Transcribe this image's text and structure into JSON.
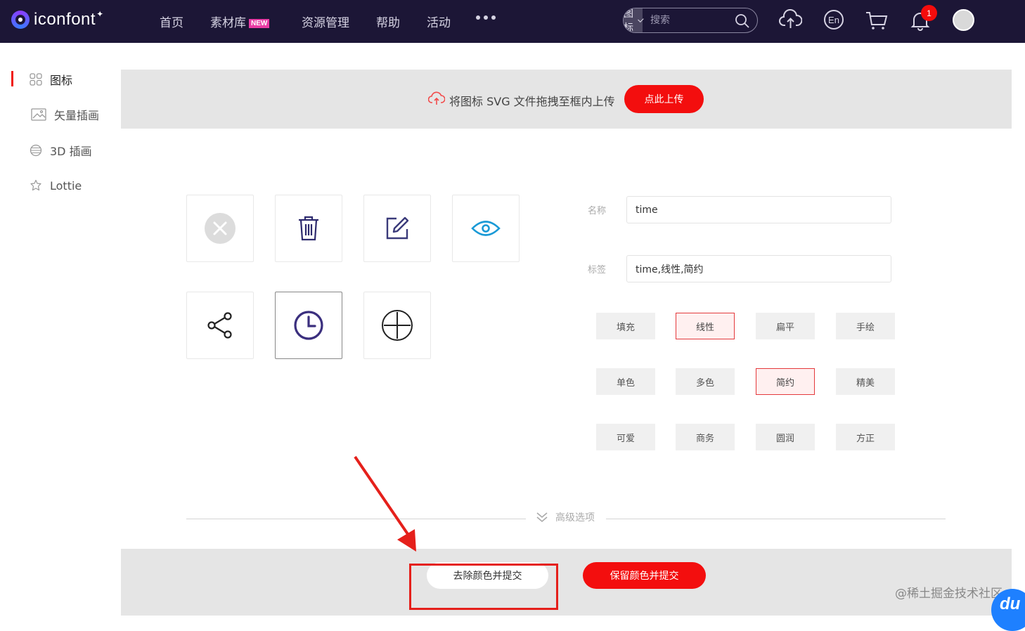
{
  "header": {
    "logo_text": "iconfont",
    "nav": [
      {
        "label": "首页"
      },
      {
        "label": "素材库",
        "badge": "NEW"
      },
      {
        "label": "资源管理"
      },
      {
        "label": "帮助"
      },
      {
        "label": "活动"
      }
    ],
    "search": {
      "type": "图标",
      "placeholder": "搜索"
    },
    "notification_count": "1",
    "icons": [
      "upload-cloud-icon",
      "language-en-icon",
      "cart-icon",
      "bell-icon"
    ]
  },
  "sidebar": {
    "items": [
      {
        "label": "图标",
        "icon": "grid-icon",
        "active": true
      },
      {
        "label": "矢量插画",
        "icon": "image-icon"
      },
      {
        "label": "3D 插画",
        "icon": "cube-icon"
      },
      {
        "label": "Lottie",
        "icon": "lottie-icon"
      }
    ]
  },
  "upload": {
    "text": "将图标 SVG 文件拖拽至框内上传",
    "button": "点此上传"
  },
  "icons": [
    {
      "name": "close-circle-icon"
    },
    {
      "name": "trash-icon"
    },
    {
      "name": "edit-icon"
    },
    {
      "name": "eye-icon"
    },
    {
      "name": "share-icon"
    },
    {
      "name": "clock-icon",
      "selected": true
    },
    {
      "name": "plus-circle-icon"
    }
  ],
  "form": {
    "name_label": "名称",
    "name_value": "time",
    "tags_label": "标签",
    "tags_value": "time,线性,简约"
  },
  "tags": [
    {
      "label": "填充"
    },
    {
      "label": "线性",
      "active": true
    },
    {
      "label": "扁平"
    },
    {
      "label": "手绘"
    },
    {
      "label": "单色"
    },
    {
      "label": "多色"
    },
    {
      "label": "简约",
      "active": true
    },
    {
      "label": "精美"
    },
    {
      "label": "可爱"
    },
    {
      "label": "商务"
    },
    {
      "label": "圆润"
    },
    {
      "label": "方正"
    }
  ],
  "advanced": "高级选项",
  "footer": {
    "remove_color_btn": "去除颜色并提交",
    "keep_color_btn": "保留颜色并提交"
  },
  "watermark": "@稀土掘金技术社区",
  "corner_logo": "du",
  "colors": {
    "accent": "#f30e0e",
    "topbar": "#1c1636",
    "clock": "#3b2f7e",
    "eye": "#1a9ad6"
  }
}
